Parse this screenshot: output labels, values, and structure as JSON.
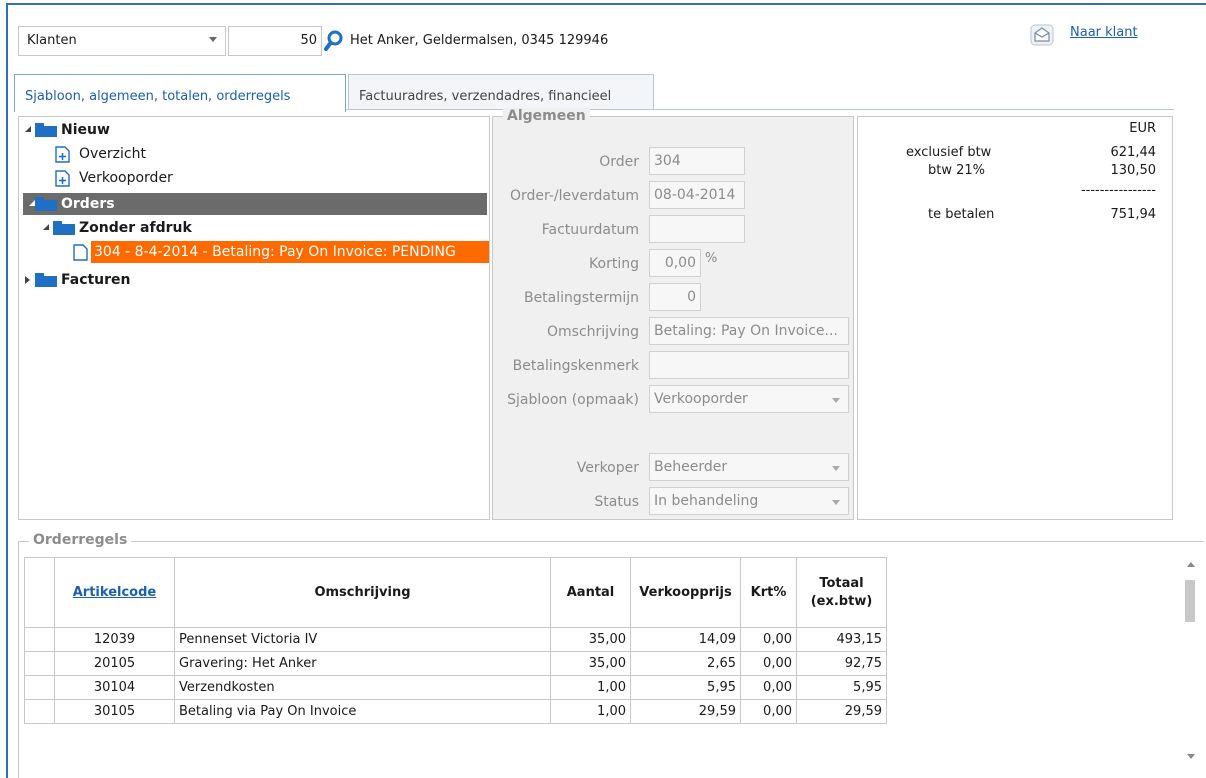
{
  "topbar": {
    "relation_type": "Klanten",
    "customer_number": "50",
    "customer_info": "Het Anker, Geldermalsen, 0345 129946",
    "naar_klant_label": "Naar klant"
  },
  "tabs": [
    {
      "label": "Sjabloon, algemeen, totalen, orderregels",
      "active": true
    },
    {
      "label": "Factuuradres, verzendadres, financieel",
      "active": false
    }
  ],
  "tree": {
    "nieuw": "Nieuw",
    "overzicht": "Overzicht",
    "verkooporder": "Verkooporder",
    "orders": "Orders",
    "zonder_afdruk": "Zonder afdruk",
    "order_item": "304 - 8-4-2014 - Betaling: Pay On Invoice: PENDING",
    "facturen": "Facturen"
  },
  "algemeen": {
    "title": "Algemeen",
    "order_label": "Order",
    "order_value": "304",
    "leverdatum_label": "Order-/leverdatum",
    "leverdatum_value": "08-04-2014",
    "factuurdatum_label": "Factuurdatum",
    "factuurdatum_value": "",
    "korting_label": "Korting",
    "korting_value": "0,00",
    "korting_unit": "%",
    "termijn_label": "Betalingstermijn",
    "termijn_value": "0",
    "omschrijving_label": "Omschrijving",
    "omschrijving_value": "Betaling: Pay On Invoice...",
    "kenmerk_label": "Betalingskenmerk",
    "kenmerk_value": "",
    "sjabloon_label": "Sjabloon (opmaak)",
    "sjabloon_value": "Verkooporder",
    "verkoper_label": "Verkoper",
    "verkoper_value": "Beheerder",
    "status_label": "Status",
    "status_value": "In behandeling"
  },
  "totals": {
    "currency": "EUR",
    "excl_label": "exclusief btw",
    "excl_value": "621,44",
    "btw_label": "btw 21%",
    "btw_value": "130,50",
    "separator": "----------------",
    "te_betalen_label": "te betalen",
    "te_betalen_value": "751,94"
  },
  "orderregels": {
    "title": "Orderregels",
    "columns": [
      "Artikelcode",
      "Omschrijving",
      "Aantal",
      "Verkoopprijs",
      "Krt%",
      "Totaal (ex.btw)"
    ],
    "rows": [
      [
        "12039",
        "Pennenset Victoria IV",
        "35,00",
        "14,09",
        "0,00",
        "493,15"
      ],
      [
        "20105",
        "Gravering: Het Anker",
        "35,00",
        "2,65",
        "0,00",
        "92,75"
      ],
      [
        "30104",
        "Verzendkosten",
        "1,00",
        "5,95",
        "0,00",
        "5,95"
      ],
      [
        "30105",
        "Betaling via Pay On Invoice",
        "1,00",
        "29,59",
        "0,00",
        "29,59"
      ]
    ]
  },
  "colors": {
    "accent": "#1a5fb4",
    "selection_orange": "#ff6a00",
    "selection_gray": "#6b6b6b",
    "folder_blue": "#1f6fc5"
  },
  "icons": [
    "search-icon",
    "mail-icon",
    "folder-icon",
    "new-document-icon",
    "document-icon"
  ]
}
